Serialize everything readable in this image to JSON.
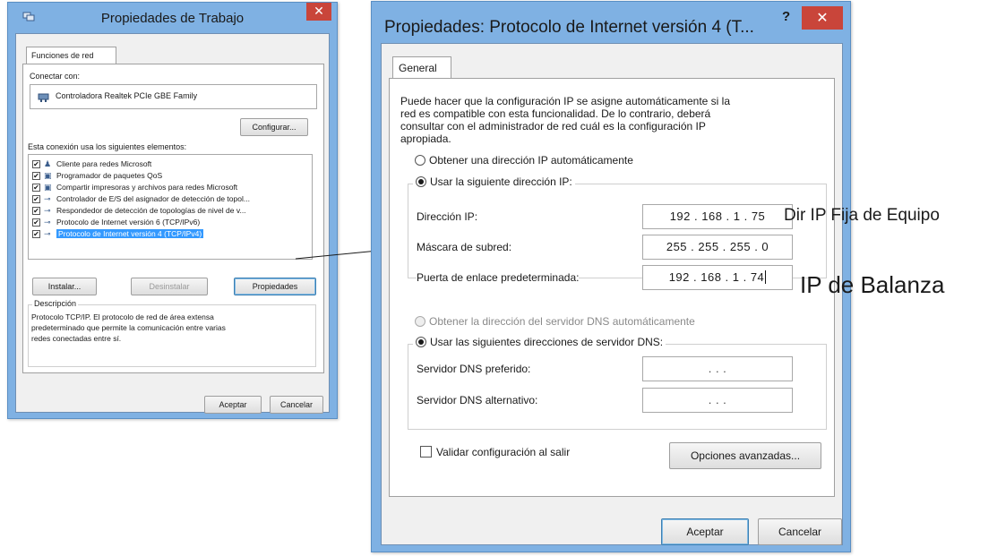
{
  "left_window": {
    "title": "Propiedades de Trabajo",
    "close_glyph": "✕",
    "tab": "Funciones de red",
    "connect_label": "Conectar con:",
    "adapter": "Controladora Realtek PCIe GBE Family",
    "configure_button": "Configurar...",
    "items_label": "Esta conexión usa los siguientes elementos:",
    "items": [
      {
        "label": "Cliente para redes Microsoft",
        "checked": true,
        "icon": "client-icon"
      },
      {
        "label": "Programador de paquetes QoS",
        "checked": true,
        "icon": "qos-icon"
      },
      {
        "label": "Compartir impresoras y archivos para redes Microsoft",
        "checked": true,
        "icon": "share-icon"
      },
      {
        "label": "Controlador de E/S del asignador de detección de topol...",
        "checked": true,
        "icon": "protocol-icon"
      },
      {
        "label": "Respondedor de detección de topologías de nivel de v...",
        "checked": true,
        "icon": "protocol-icon"
      },
      {
        "label": "Protocolo de Internet versión 6 (TCP/IPv6)",
        "checked": true,
        "icon": "protocol-icon"
      },
      {
        "label": "Protocolo de Internet versión 4 (TCP/IPv4)",
        "checked": true,
        "icon": "protocol-icon",
        "selected": true
      }
    ],
    "check_glyph": "✔",
    "install_button": "Instalar...",
    "uninstall_button": "Desinstalar",
    "properties_button": "Propiedades",
    "description_label": "Descripción",
    "description_text_1": "Protocolo TCP/IP. El protocolo de red de área extensa",
    "description_text_2": "predeterminado que permite la comunicación entre varias",
    "description_text_3": "redes conectadas entre sí.",
    "ok_button": "Aceptar",
    "cancel_button": "Cancelar"
  },
  "right_window": {
    "title": "Propiedades: Protocolo de Internet versión 4 (T...",
    "help_glyph": "?",
    "close_glyph": "✕",
    "tab": "General",
    "intro_1": "Puede hacer que la configuración IP se asigne automáticamente si la",
    "intro_2": "red es compatible con esta funcionalidad. De lo contrario, deberá",
    "intro_3": "consultar con el administrador de red cuál es la configuración IP",
    "intro_4": "apropiada.",
    "radio_auto_ip": "Obtener una dirección IP automáticamente",
    "radio_manual_ip": "Usar la siguiente dirección IP:",
    "ip_label": "Dirección IP:",
    "ip_value": "192 . 168 . 1 . 75",
    "mask_label": "Máscara de subred:",
    "mask_value": "255 . 255 . 255 . 0",
    "gateway_label": "Puerta de enlace predeterminada:",
    "gateway_value": "192 . 168 . 1 . 74",
    "radio_auto_dns": "Obtener la dirección del servidor DNS automáticamente",
    "radio_manual_dns": "Usar las siguientes direcciones de servidor DNS:",
    "dns_pref_label": "Servidor DNS preferido:",
    "dns_pref_value": ".      .      .",
    "dns_alt_label": "Servidor DNS alternativo:",
    "dns_alt_value": ".      .      .",
    "validate_label": "Validar configuración al salir",
    "advanced_button": "Opciones avanzadas...",
    "ok_button": "Aceptar",
    "cancel_button": "Cancelar"
  },
  "annotations": {
    "fixed_ip": "Dir IP Fija de Equipo",
    "scale_ip": "IP de Balanza"
  }
}
